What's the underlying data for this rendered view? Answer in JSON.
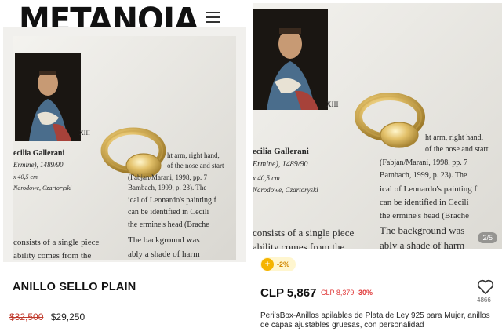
{
  "left_card": {
    "brand": "METANOIA",
    "product_title": "ANILLO SELLO PLAIN",
    "old_price": "$32,500",
    "new_price": "$29,250"
  },
  "right_card": {
    "image_counter": "2/5",
    "badge_text": "-2%",
    "price": "CLP 5,867",
    "old_price": "CLP 8,379",
    "discount": "-30%",
    "likes": "4866",
    "description": "Peri'sBox-Anillos apilables de Plata de Ley 925 para Mujer, anillos de capas ajustables gruesas, con personalidad"
  },
  "photo_book_text": {
    "plate_number": "XIII",
    "heading": "ecilia Gallerani",
    "subheading": "Ermine), 1489/90",
    "dimensions": "x 40,5 cm",
    "museum": "Narodowe, Czartoryski",
    "col2": [
      "ht arm, right hand,",
      "of the nose and start",
      "(Fabjan/Marani, 1998, pp. 7",
      "Bambach, 1999, p. 23). The",
      "ical of Leonardo's painting f",
      "can be identified in Cecili",
      "the ermine's head (Brache",
      "The background was",
      "ably a shade of harm"
    ],
    "body_left": [
      "consists of a single piece",
      "ability comes from the"
    ]
  },
  "colors": {
    "price_strike": "#c0392b",
    "discount_red": "#e03b3b",
    "badge_gold": "#f5b400",
    "page_paper": "#efeeea"
  },
  "icons": [
    "menu-icon",
    "heart-icon",
    "coin-icon"
  ]
}
